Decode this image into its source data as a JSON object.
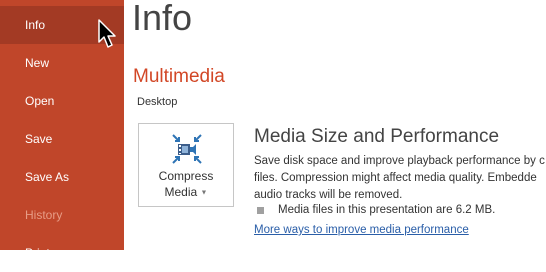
{
  "nav": {
    "items": [
      {
        "label": "Info"
      },
      {
        "label": "New"
      },
      {
        "label": "Open"
      },
      {
        "label": "Save"
      },
      {
        "label": "Save As"
      },
      {
        "label": "History"
      },
      {
        "label": "Print"
      }
    ]
  },
  "page": {
    "title": "Info",
    "section_title": "Multimedia",
    "section_subtitle": "Desktop"
  },
  "compress": {
    "line1": "Compress",
    "line2": "Media",
    "icon": "compress-media-icon"
  },
  "media_info": {
    "title": "Media Size and Performance",
    "desc_line1": "Save disk space and improve playback performance by c",
    "desc_line2": "files. Compression might affect media quality. Embedde",
    "desc_line3": "audio tracks will be removed.",
    "bullet_text": "Media files in this presentation are 6.2 MB.",
    "link_text": "More ways to improve media performance"
  },
  "colors": {
    "sidebar": "#c0462a",
    "active_item": "#a33a24",
    "accent": "#d24726",
    "link": "#2a5ea8"
  }
}
